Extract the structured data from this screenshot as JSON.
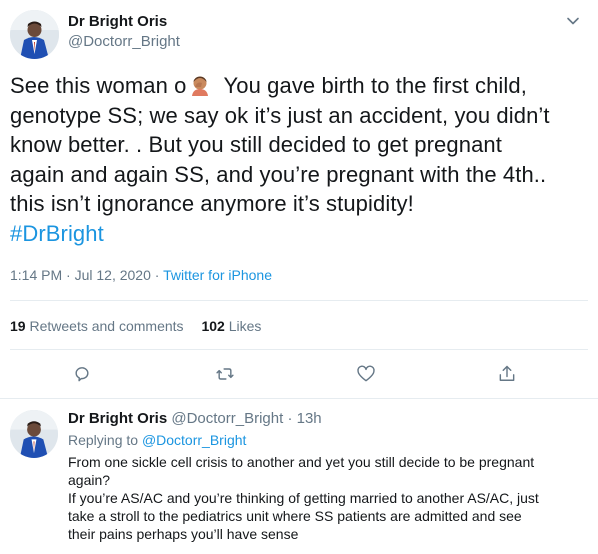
{
  "tweet": {
    "author_name": "Dr Bright Oris",
    "author_handle": "@Doctorr_Bright",
    "text_lines": [
      "See this woman o",
      "genotype SS; we say ok it’s just an accident, you didn’t",
      "know better. . But you still decided to get pregnant",
      "again and again SS, and you’re pregnant with the 4th..",
      "this isn’t ignorance anymore it’s stupidity!"
    ],
    "text_line1_after_emoji": "You gave birth to the first child,",
    "hashtag": "#DrBright",
    "timestamp": "1:14 PM · Jul 12, 2020 · ",
    "source": "Twitter for iPhone",
    "retweets_count": "19",
    "retweets_label": "Retweets and comments",
    "likes_count": "102",
    "likes_label": "Likes",
    "emoji": "facepalm-emoji"
  },
  "actions": {
    "reply_icon": "comment-icon",
    "retweet_icon": "retweet-icon",
    "like_icon": "heart-icon",
    "share_icon": "share-icon"
  },
  "reply": {
    "author_name": "Dr Bright Oris",
    "author_handle": "@Doctorr_Bright · 13h",
    "replying_to_label": "Replying to",
    "replying_to_mention": "@Doctorr_Bright",
    "text_lines": [
      "From one sickle cell crisis to another and yet you still decide to be pregnant",
      "again?",
      "If you’re AS/AC and you’re thinking of getting married to another AS/AC, just",
      "take a stroll to the pediatrics unit where SS patients are admitted and see",
      "their pains perhaps you’ll have sense"
    ]
  },
  "colors": {
    "link": "#1b95e0",
    "secondary_text": "#657786",
    "primary_text": "#14171a",
    "divider": "#e6ecf0"
  }
}
